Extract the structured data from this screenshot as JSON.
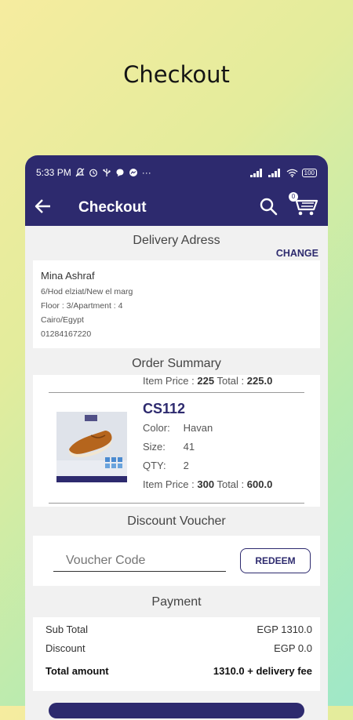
{
  "headline": "Checkout",
  "status_bar": {
    "time": "5:33 PM",
    "more": "···",
    "battery": "100"
  },
  "app_bar": {
    "title": "Checkout",
    "cart_count": "0"
  },
  "delivery": {
    "section_title": "Delivery Adress",
    "change_label": "CHANGE",
    "name": "Mina Ashraf",
    "lines": [
      "6/Hod elziat/New el marg",
      "Floor : 3/Apartment : 4",
      "Cairo/Egypt",
      "01284167220"
    ]
  },
  "order_summary": {
    "section_title": "Order Summary",
    "prev_item": {
      "price_label": "Item Price :",
      "price": "225",
      "total_label": "Total :",
      "total": "225.0"
    },
    "item": {
      "code": "CS112",
      "color_label": "Color:",
      "color": "Havan",
      "size_label": "Size:",
      "size": "41",
      "qty_label": "QTY:",
      "qty": "2",
      "price_label": "Item Price :",
      "price": "300",
      "total_label": "Total :",
      "total": "600.0"
    }
  },
  "voucher": {
    "section_title": "Discount Voucher",
    "placeholder": "Voucher Code",
    "redeem_label": "REDEEM"
  },
  "payment": {
    "section_title": "Payment",
    "subtotal_label": "Sub Total",
    "subtotal": "EGP 1310.0",
    "discount_label": "Discount",
    "discount": "EGP 0.0",
    "total_label": "Total amount",
    "total": "1310.0 + delivery fee"
  },
  "colors": {
    "primary": "#2d2a6e",
    "screen_bg": "#f1f1f1"
  }
}
